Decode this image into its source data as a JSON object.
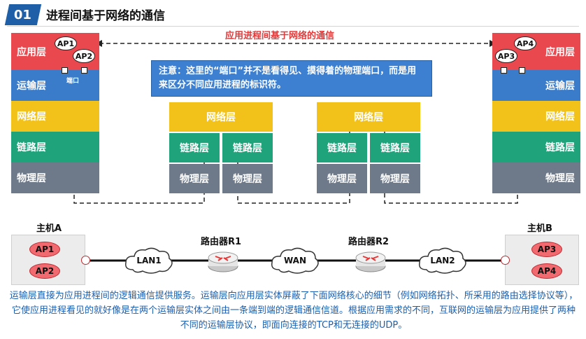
{
  "header": {
    "number": "01",
    "title": "进程间基于网络的通信"
  },
  "diagram": {
    "top_label": "应用进程间基于网络的通信",
    "note": "注意：这里的“端口”并不是看得见、摸得着的物理端口，而是用来区分不同应用进程的标识符。",
    "left_stack": [
      "应用层",
      "运输层",
      "网络层",
      "链路层",
      "物理层"
    ],
    "right_stack": [
      "应用层",
      "运输层",
      "网络层",
      "链路层",
      "物理层"
    ],
    "port_label": "端口",
    "processes": {
      "left_top": "AP1",
      "left_bottom": "AP2",
      "right_left": "AP3",
      "right_right": "AP4"
    },
    "router1_stack": {
      "network": "网络层",
      "link_left": "链路层",
      "link_right": "链路层",
      "phy_left": "物理层",
      "phy_right": "物理层"
    },
    "router2_stack": {
      "network": "网络层",
      "link_left": "链路层",
      "link_right": "链路层",
      "phy_left": "物理层",
      "phy_right": "物理层"
    }
  },
  "network": {
    "host_a": {
      "label": "主机A",
      "apps": [
        "AP1",
        "AP2"
      ]
    },
    "host_b": {
      "label": "主机B",
      "apps": [
        "AP3",
        "AP4"
      ]
    },
    "router1": "路由器R1",
    "router2": "路由器R2",
    "clouds": [
      "LAN1",
      "WAN",
      "LAN2"
    ]
  },
  "caption": "运输层直接为应用进程间的逻辑通信提供服务。运输层向应用层实体屏蔽了下面网络核心的细节（例如网络拓扑、所采用的路由选择协议等），它使应用进程看见的就好像是在两个运输层实体之间由一条端到端的逻辑通信信道。根据应用需求的不同，互联网的运输层为应用提供了两种不同的运输层协议，即面向连接的TCP和无连接的UDP。",
  "colors": {
    "application": "#e8484e",
    "transport": "#3a7cc9",
    "network": "#f2c21b",
    "link": "#1fa37a",
    "physical": "#6e7a8a",
    "title_red": "#e13a3a",
    "caption_blue": "#1a5fb0"
  }
}
